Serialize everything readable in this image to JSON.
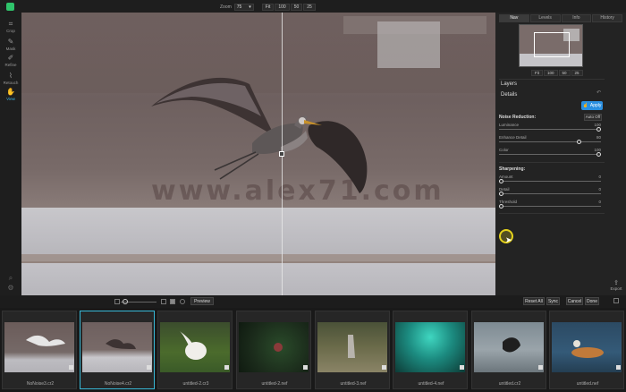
{
  "toolbar": {
    "zoom_label": "Zoom",
    "zoom_value": "75",
    "zoom_buttons": [
      "Fit",
      "100",
      "50",
      "25"
    ]
  },
  "tools": [
    {
      "label": "Crop",
      "icon": "crop-icon",
      "active": false
    },
    {
      "label": "Mask",
      "icon": "brush-icon",
      "active": false
    },
    {
      "label": "Refine",
      "icon": "refine-icon",
      "active": false
    },
    {
      "label": "Retouch",
      "icon": "retouch-icon",
      "active": false
    },
    {
      "label": "View",
      "icon": "view-icon",
      "active": true
    }
  ],
  "canvas": {
    "watermark": "www.alex71.com"
  },
  "panel": {
    "tabs": [
      "Nav",
      "Levels",
      "Info",
      "History"
    ],
    "active_tab": "Nav",
    "nav_zoom": [
      "Fit",
      "100",
      "50",
      "25"
    ],
    "layers_title": "Layers",
    "details_title": "Details",
    "apply_label": "Apply",
    "noise": {
      "title": "Noise Reduction:",
      "auto_label": "Auto Off",
      "sliders": [
        {
          "label": "Luminance",
          "value": "100",
          "pos": 1.0
        },
        {
          "label": "Enhance Detail",
          "value": "80",
          "pos": 0.8
        },
        {
          "label": "Color",
          "value": "100",
          "pos": 1.0
        }
      ]
    },
    "sharpening": {
      "title": "Sharpening:",
      "sliders": [
        {
          "label": "Amount",
          "value": "0",
          "pos": 0.0
        },
        {
          "label": "Detail",
          "value": "0",
          "pos": 0.0
        },
        {
          "label": "Threshold",
          "value": "0",
          "pos": 0.0
        }
      ]
    },
    "export_label": "Export"
  },
  "controls": {
    "preview_label": "Preview",
    "reset_all_label": "Reset All",
    "sync_label": "Sync",
    "cancel_label": "Cancel",
    "done_label": "Done"
  },
  "filmstrip": [
    {
      "name": "NoNoise3.cr2",
      "selected": false
    },
    {
      "name": "NoNoise4.cr2",
      "selected": true
    },
    {
      "name": "untitled-2.cr3",
      "selected": false
    },
    {
      "name": "untitled-2.nef",
      "selected": false
    },
    {
      "name": "untitled-3.nef",
      "selected": false
    },
    {
      "name": "untitled-4.nef",
      "selected": false
    },
    {
      "name": "untitled.cr2",
      "selected": false
    },
    {
      "name": "untitled.nef",
      "selected": false
    }
  ],
  "colors": {
    "accent": "#2a8fe0",
    "active_tool": "#3fb6e8",
    "selected_thumb": "#37b8d6",
    "cursor_ring": "#e5d21c"
  }
}
